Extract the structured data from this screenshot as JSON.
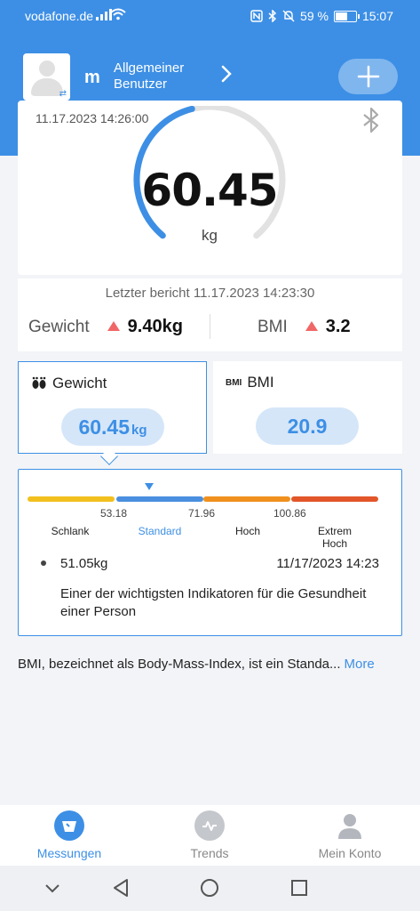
{
  "status_bar": {
    "carrier": "vodafone.de",
    "battery": "59 %",
    "time": "15:07"
  },
  "user": {
    "initial": "m",
    "name": "Allgemeiner Benutzer"
  },
  "measurement": {
    "timestamp": "11.17.2023 14:26:00",
    "weight": "60.45",
    "unit": "kg",
    "gauge_fraction": 0.45
  },
  "last_report": {
    "label": "Letzter bericht 11.17.2023 14:23:30",
    "weight_label": "Gewicht",
    "weight_diff": "9.40kg",
    "bmi_label": "BMI",
    "bmi_diff": "3.2"
  },
  "tabs": {
    "weight": {
      "label": "Gewicht",
      "value": "60.45",
      "unit": "kg"
    },
    "bmi": {
      "badge": "BMI",
      "label": "BMI",
      "value": "20.9"
    }
  },
  "scale": {
    "ticks": [
      "53.18",
      "71.96",
      "100.86"
    ],
    "zones": [
      "Schlank",
      "Standard",
      "Hoch",
      "Extrem\nHoch"
    ],
    "colors": [
      "#f2c01e",
      "#4a8fe0",
      "#f0901e",
      "#e2562a"
    ],
    "active_zone": 1,
    "history_value": "51.05kg",
    "history_date": "11/17/2023 14:23",
    "description": "Einer der wichtigsten Indikatoren für die Gesundheit einer Person"
  },
  "bmi_info": {
    "text": "BMI, bezeichnet als Body-Mass-Index, ist ein Standa...",
    "more": "More"
  },
  "nav": {
    "measurements": "Messungen",
    "trends": "Trends",
    "account": "Mein Konto"
  },
  "colors": {
    "primary": "#3d8fe5",
    "increase": "#f06767"
  }
}
